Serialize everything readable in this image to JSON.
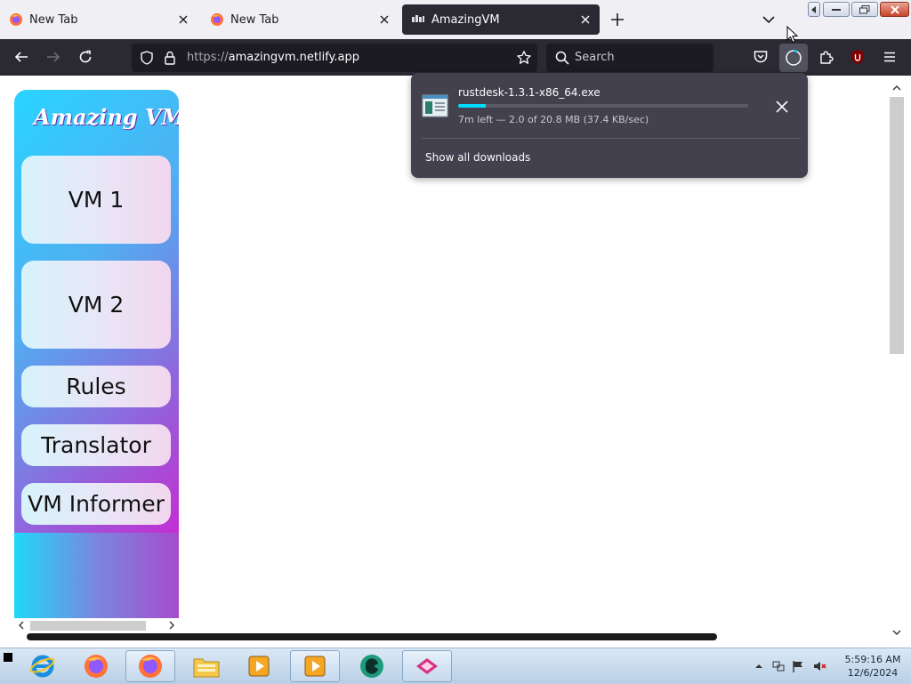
{
  "browser": {
    "tabs": [
      {
        "title": "New Tab",
        "active": false,
        "icon": "firefox-icon"
      },
      {
        "title": "New Tab",
        "active": false,
        "icon": "firefox-icon"
      },
      {
        "title": "AmazingVM",
        "active": true,
        "icon": "site-favicon"
      }
    ],
    "url_scheme": "https://",
    "url_host": "amazingvm.netlify.app",
    "search_placeholder": "Search",
    "extension_badge": "2"
  },
  "downloads_panel": {
    "filename": "rustdesk-1.3.1-x86_64.exe",
    "progress_fraction": 0.096,
    "status": "7m left — 2.0 of 20.8 MB (37.4 KB/sec)",
    "show_all_label": "Show all downloads"
  },
  "site": {
    "logo_text": "Amazing VM",
    "buttons": [
      {
        "label": "VM 1"
      },
      {
        "label": "VM 2"
      },
      {
        "label": "Rules"
      },
      {
        "label": "Translator"
      },
      {
        "label": "VM Informer"
      }
    ]
  },
  "taskbar": {
    "clock_time": "5:59:16 AM",
    "clock_date": "12/6/2024",
    "apps": [
      "internet-explorer-icon",
      "firefox-icon",
      "firefox-icon",
      "file-explorer-icon",
      "media-player-icon",
      "media-player-icon",
      "green-app-icon",
      "pink-app-icon"
    ]
  },
  "colors": {
    "tab_active_bg": "#2b2a33",
    "toolbar_bg": "#2b2a33",
    "progress_fill": "#00ddff",
    "sidebar_gradient_start": "#29d4ff",
    "sidebar_gradient_end": "#e010d0"
  }
}
